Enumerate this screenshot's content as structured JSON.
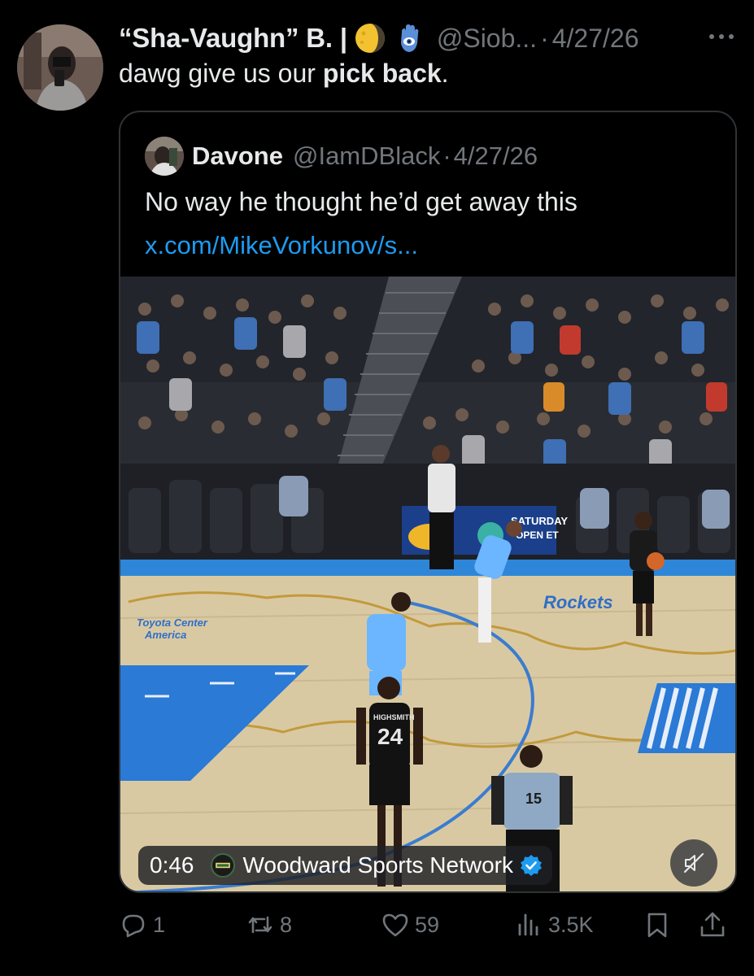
{
  "tweet": {
    "display_name": "“Sha-Vaughn” B. |",
    "badges": [
      "moon-emoji-icon",
      "hamsa-emoji-icon"
    ],
    "handle": "@Siob...",
    "separator": "·",
    "date": "4/27/26",
    "text_plain": "dawg give us our ",
    "text_bold": "pick back",
    "text_end": "."
  },
  "quote": {
    "display_name": "Davone",
    "handle": "@IamDBlack",
    "separator": "·",
    "date": "4/27/26",
    "text": "No way he thought he’d get away this",
    "link": "x.com/MikeVorkunov/s...",
    "video": {
      "timestamp": "0:46",
      "source": "Woodward Sports Network",
      "source_logo_text": "WOODWARD SPORTS",
      "jersey_front_name": "HIGHSMITH",
      "jersey_front_number": "24",
      "referee_number": "15",
      "banner_text": "SATURDAY OPEN ET",
      "court_text_left": "Toyota Center America",
      "court_text_right": "Rockets"
    }
  },
  "actions": {
    "replies": "1",
    "reposts": "8",
    "likes": "59",
    "views": "3.5K"
  },
  "colors": {
    "background": "#000000",
    "text": "#e7e9ea",
    "muted": "#71767b",
    "link": "#1d9bf0",
    "border": "#2f3336"
  }
}
